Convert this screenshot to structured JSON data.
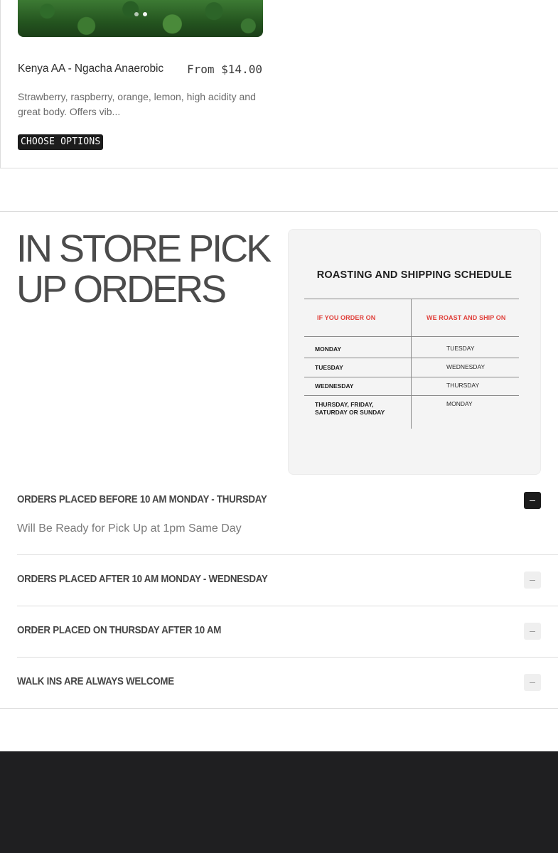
{
  "product": {
    "title": "Kenya AA - Ngacha Anaerobic",
    "price": "From $14.00",
    "description": "Strawberry, raspberry, orange, lemon, high acidity and great body. Offers vib...",
    "button_label": "CHOOSE OPTIONS",
    "carousel": {
      "slides": 2,
      "active": 2
    }
  },
  "pickup": {
    "heading": "IN STORE PICK UP ORDERS",
    "schedule": {
      "title": "ROASTING AND SHIPPING SCHEDULE",
      "col1_header": "IF YOU ORDER ON",
      "col2_header": "WE ROAST AND SHIP ON",
      "rows": [
        {
          "order_day": "MONDAY",
          "ship_day": "TUESDAY"
        },
        {
          "order_day": "TUESDAY",
          "ship_day": "WEDNESDAY"
        },
        {
          "order_day": "WEDNESDAY",
          "ship_day": "THURSDAY"
        },
        {
          "order_day_line1": "THURSDAY, FRIDAY,",
          "order_day_line2": "SATURDAY OR SUNDAY",
          "ship_day": "MONDAY"
        }
      ],
      "header_color": "#e0423d"
    },
    "accordion": [
      {
        "title": "ORDERS PLACED BEFORE 10 AM MONDAY - THURSDAY",
        "body": "Will Be Ready for Pick Up at 1pm Same Day",
        "open": true
      },
      {
        "title": "ORDERS PLACED AFTER 10 AM MONDAY - WEDNESDAY",
        "open": false
      },
      {
        "title": "ORDER PLACED ON THURSDAY AFTER 10 AM",
        "open": false
      },
      {
        "title": "WALK INS ARE ALWAYS WELCOME",
        "open": false
      }
    ]
  },
  "colors": {
    "footer_bg": "#1f1f21",
    "button_bg": "#1c1c1c",
    "accent_red": "#e0423d"
  }
}
